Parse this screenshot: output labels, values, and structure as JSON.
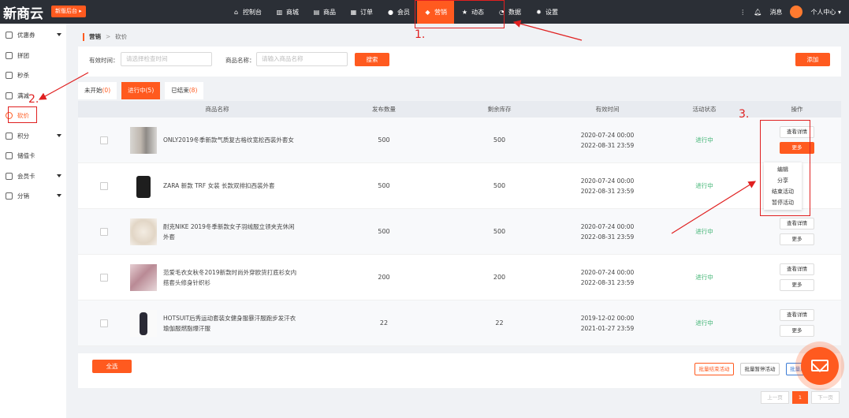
{
  "brand": {
    "logo": "新商云",
    "switch_label": "新版后台 ▸"
  },
  "nav": {
    "items": [
      {
        "label": "控制台",
        "icon": "home-icon"
      },
      {
        "label": "商城",
        "icon": "shop-icon"
      },
      {
        "label": "商品",
        "icon": "goods-icon"
      },
      {
        "label": "订单",
        "icon": "order-icon"
      },
      {
        "label": "会员",
        "icon": "user-icon"
      },
      {
        "label": "营销",
        "icon": "marketing-icon",
        "active": true
      },
      {
        "label": "动态",
        "icon": "star-icon"
      },
      {
        "label": "数据",
        "icon": "chart-icon"
      },
      {
        "label": "设置",
        "icon": "gear-icon"
      }
    ],
    "message_label": "消息",
    "user_label": "个人中心"
  },
  "sidebar": {
    "items": [
      {
        "label": "优惠券",
        "has_caret": true
      },
      {
        "label": "拼团"
      },
      {
        "label": "秒杀"
      },
      {
        "label": "满减"
      },
      {
        "label": "砍价",
        "active": true
      },
      {
        "label": "积分",
        "has_caret": true
      },
      {
        "label": "储值卡"
      },
      {
        "label": "会员卡",
        "has_caret": true
      },
      {
        "label": "分销",
        "has_caret": true
      }
    ]
  },
  "breadcrumb": {
    "root": "营销",
    "sep": ">",
    "current": "砍价"
  },
  "filter": {
    "time_label": "有效时间：",
    "time_placeholder": "请选择检查时间",
    "name_label": "商品名称：",
    "name_placeholder": "请输入商品名称",
    "search_label": "搜索",
    "add_label": "添加"
  },
  "tabs": [
    {
      "label": "未开始",
      "count": "(0)"
    },
    {
      "label": "进行中",
      "count": "(5)",
      "active": true
    },
    {
      "label": "已结束",
      "count": "(8)"
    }
  ],
  "table": {
    "headers": [
      "商品名称",
      "发布数量",
      "剩余库存",
      "有效时间",
      "活动状态",
      "操作"
    ],
    "rows": [
      {
        "name": "ONLY2019冬季新款气质复古格纹宽松西装外套女",
        "qty": "500",
        "stock": "500",
        "start": "2020-07-24 00:00",
        "end": "2022-08-31 23:59",
        "status": "进行中"
      },
      {
        "name": "ZARA 新款 TRF 女装 长款双排扣西装外套",
        "qty": "500",
        "stock": "500",
        "start": "2020-07-24 00:00",
        "end": "2022-08-31 23:59",
        "status": "进行中"
      },
      {
        "name": "耐克NIKE 2019冬季新款女子羽绒服立领夹克休闲外套",
        "qty": "500",
        "stock": "500",
        "start": "2020-07-24 00:00",
        "end": "2022-08-31 23:59",
        "status": "进行中"
      },
      {
        "name": "范爱毛衣女秋冬2019新款时尚外穿欧货打底衫女内搭套头修身针织衫",
        "qty": "200",
        "stock": "200",
        "start": "2020-07-24 00:00",
        "end": "2022-08-31 23:59",
        "status": "进行中"
      },
      {
        "name": "HOTSUIT后秀运动套装女健身服暴汗服跑步发汗衣瑜伽服燃脂爆汗服",
        "qty": "22",
        "stock": "22",
        "start": "2019-12-02 00:00",
        "end": "2021-01-27 23:59",
        "status": "进行中"
      }
    ],
    "detail_label": "查看详情",
    "more_label": "更多"
  },
  "dropdown": {
    "items": [
      "编辑",
      "分享",
      "结束活动",
      "暂停活动"
    ]
  },
  "footer": {
    "select_all": "全选",
    "batch_end": "批量结束活动",
    "batch_pause": "批量暂停活动",
    "batch_resume": "批量启"
  },
  "pager": {
    "prev": "上一页",
    "current": "1",
    "next": "下一页"
  },
  "annotations": {
    "n1": "1.",
    "n2": "2.",
    "n3": "3."
  },
  "colors": {
    "accent": "#ff5a1f",
    "topbar": "#2b2f36",
    "status_green": "#3cb371",
    "annotation": "#e02020"
  }
}
